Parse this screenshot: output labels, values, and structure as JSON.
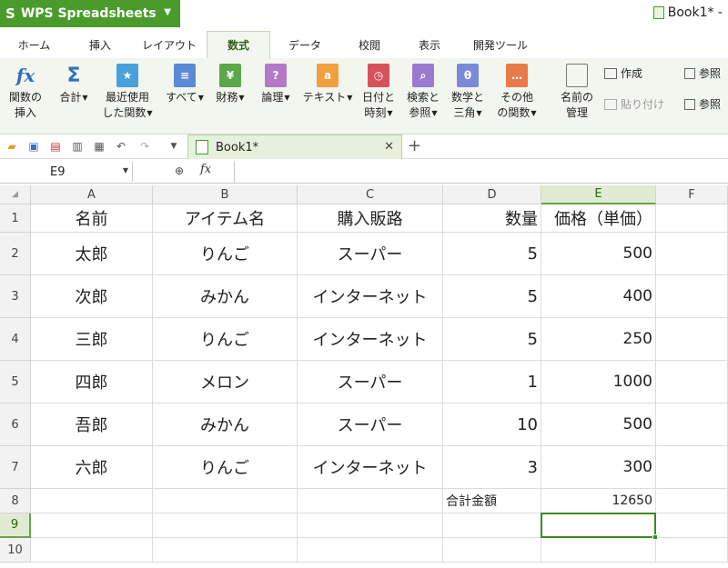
{
  "app": {
    "title": "WPS Spreadsheets",
    "window_title": "Book1* -"
  },
  "ribbon_tabs": [
    "ホーム",
    "挿入",
    "レイアウト",
    "数式",
    "データ",
    "校閲",
    "表示",
    "開発ツール"
  ],
  "active_tab": "数式",
  "ribbon": {
    "insert_function": [
      "関数の",
      "挿入"
    ],
    "sum": "合計",
    "recent": [
      "最近使用",
      "した関数"
    ],
    "all": "すべて",
    "finance": "財務",
    "logic": "論理",
    "text": "テキスト",
    "datetime": [
      "日付と",
      "時刻"
    ],
    "lookup": [
      "検索と",
      "参照"
    ],
    "math": [
      "数学と",
      "三角"
    ],
    "other": [
      "その他",
      "の関数"
    ],
    "name_manager": [
      "名前の",
      "管理"
    ],
    "create": "作成",
    "paste": "貼り付け",
    "trace1": "参照",
    "trace2": "参照"
  },
  "document_tab": "Book1*",
  "name_box": "E9",
  "formula": "",
  "columns": [
    "A",
    "B",
    "C",
    "D",
    "E",
    "F"
  ],
  "rows": [
    "1",
    "2",
    "3",
    "4",
    "5",
    "6",
    "7",
    "8",
    "9",
    "10"
  ],
  "cells": {
    "r1": [
      "名前",
      "アイテム名",
      "購入販路",
      "数量",
      "価格（単価）",
      ""
    ],
    "r2": [
      "太郎",
      "りんご",
      "スーパー",
      "5",
      "500",
      ""
    ],
    "r3": [
      "次郎",
      "みかん",
      "インターネット",
      "5",
      "400",
      ""
    ],
    "r4": [
      "三郎",
      "りんご",
      "インターネット",
      "5",
      "250",
      ""
    ],
    "r5": [
      "四郎",
      "メロン",
      "スーパー",
      "1",
      "1000",
      ""
    ],
    "r6": [
      "吾郎",
      "みかん",
      "スーパー",
      "10",
      "500",
      ""
    ],
    "r7": [
      "六郎",
      "りんご",
      "インターネット",
      "3",
      "300",
      ""
    ],
    "r8": [
      "",
      "",
      "",
      "合計金額",
      "12650",
      ""
    ],
    "r9": [
      "",
      "",
      "",
      "",
      "",
      ""
    ],
    "r10": [
      "",
      "",
      "",
      "",
      "",
      ""
    ]
  },
  "colors": {
    "brand_green": "#4a9b2b",
    "selection": "#3c8a24"
  }
}
